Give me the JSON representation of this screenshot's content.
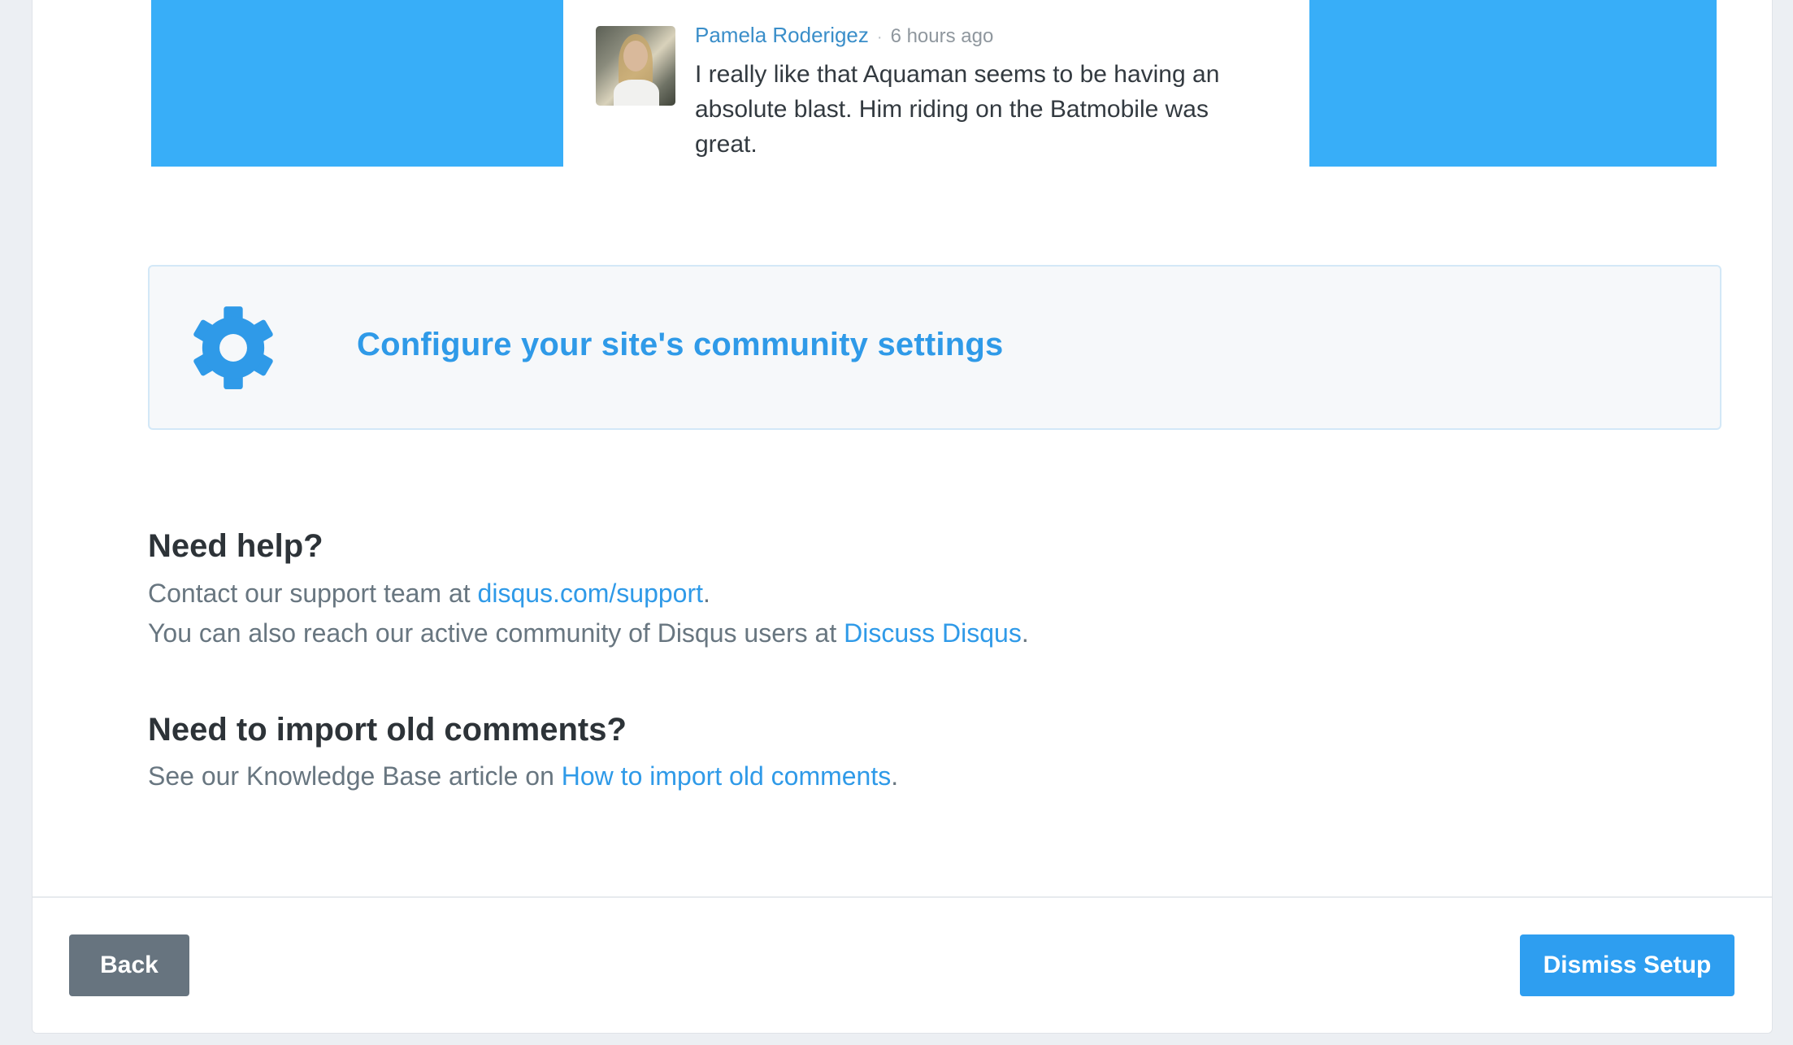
{
  "preview": {
    "comment": {
      "author": "Pamela Roderigez",
      "separator": "·",
      "time": "6 hours ago",
      "text": "I really like that Aquaman seems to be having an absolute blast. Him riding on the Batmobile was great."
    }
  },
  "settings_link": {
    "label": "Configure your site's community settings",
    "icon": "gear-icon"
  },
  "help": {
    "title": "Need help?",
    "line1_prefix": "Contact our support team at ",
    "line1_link": "disqus.com/support",
    "line1_suffix": ".",
    "line2_prefix": "You can also reach our active community of Disqus users at ",
    "line2_link": "Discuss Disqus",
    "line2_suffix": "."
  },
  "import": {
    "title": "Need to import old comments?",
    "line_prefix": "See our Knowledge Base article on ",
    "line_link": "How to import old comments",
    "line_suffix": "."
  },
  "footer": {
    "back_label": "Back",
    "dismiss_label": "Dismiss Setup"
  },
  "colors": {
    "accent": "#2f9ae8",
    "preview_bg": "#38aef8",
    "back_button": "#67747f",
    "dismiss_button": "#2e9ef0"
  }
}
